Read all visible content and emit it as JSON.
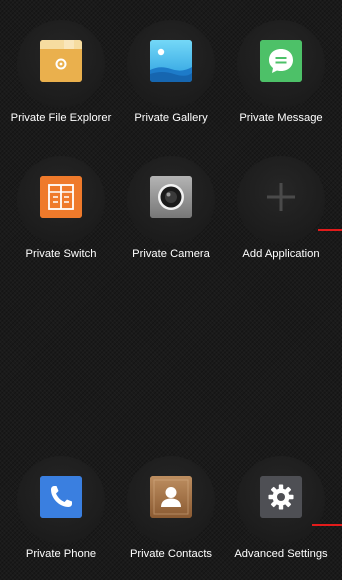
{
  "apps": [
    {
      "label": "Private File Explorer",
      "icon": "folder-icon"
    },
    {
      "label": "Private Gallery",
      "icon": "image-icon"
    },
    {
      "label": "Private Message",
      "icon": "message-bubble-icon"
    },
    {
      "label": "Private Switch",
      "icon": "switch-icon"
    },
    {
      "label": "Private Camera",
      "icon": "camera-icon"
    },
    {
      "label": "Add Application",
      "icon": "plus-icon"
    }
  ],
  "dock": [
    {
      "label": "Private Phone",
      "icon": "phone-icon"
    },
    {
      "label": "Private Contacts",
      "icon": "contact-icon"
    },
    {
      "label": "Advanced Settings",
      "icon": "gear-icon"
    }
  ],
  "colors": {
    "background": "#1a1a1a",
    "accent_red": "#e21b1b",
    "explorer_tile": "#eab04d",
    "gallery_tile": "#2b9fe0",
    "message_tile": "#4dc168",
    "switch_tile": "#ef7a2b",
    "camera_tile": "#8f8f8f",
    "phone_tile": "#3a7fe0",
    "contacts_tile": "#9e6b3f",
    "settings_tile": "#4e4f54"
  }
}
